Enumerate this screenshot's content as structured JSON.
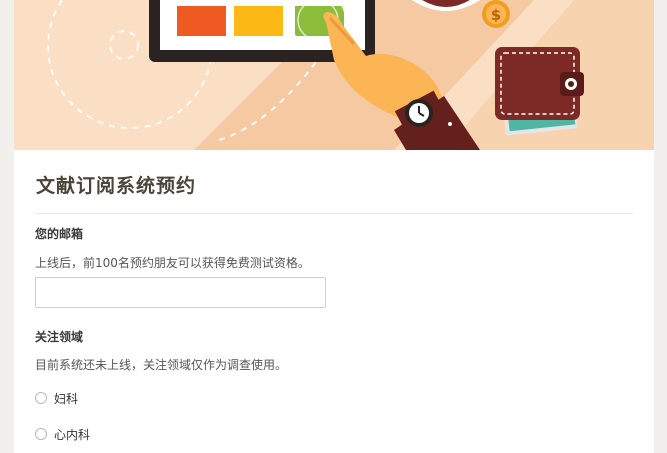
{
  "form": {
    "title": "文献订阅系统预约"
  },
  "email_question": {
    "label": "您的邮箱",
    "description": "上线后，前100名预约朋友可以获得免费测试资格。",
    "value": ""
  },
  "field_question": {
    "label": "关注领域",
    "description": "目前系统还未上线，关注领域仅作为调查使用。",
    "options": [
      {
        "label": "妇科",
        "selected": false
      },
      {
        "label": "心内科",
        "selected": false
      }
    ]
  },
  "banner": {
    "icons": [
      "tablet-icon",
      "hand-pointer-icon",
      "wristwatch-icon",
      "wallet-icon",
      "dollar-coin-icon"
    ],
    "coin_symbol": "$",
    "colors": {
      "background": "#fbdfc4",
      "tablet_frame": "#2a2321",
      "tile_orange": "#ef5a22",
      "tile_yellow": "#fcb915",
      "tile_green": "#8bbd3a",
      "hand": "#fcb555",
      "sleeve": "#63201c",
      "wallet": "#7d2a26",
      "coin": "#f29d1e"
    }
  }
}
